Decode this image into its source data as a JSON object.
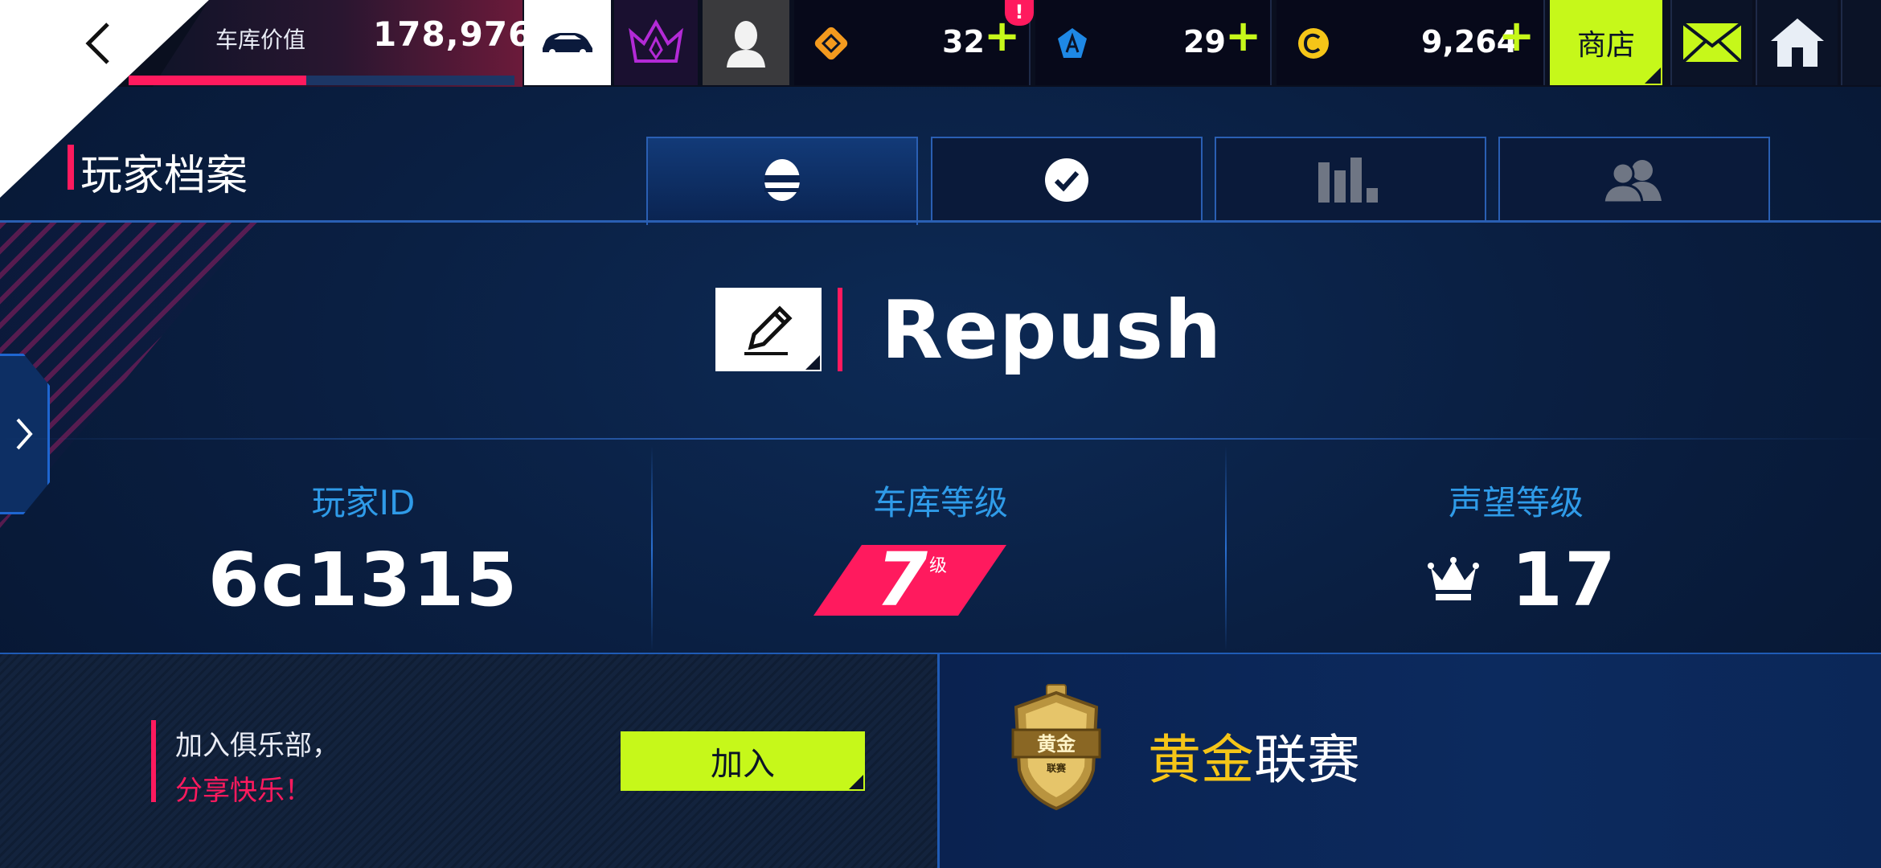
{
  "topbar": {
    "garage_value_label": "车库价值",
    "garage_value": "178,976",
    "garage_value_progress": 0.46,
    "tokens": "32",
    "blueprints": "29",
    "credits": "9,264",
    "plus": "+",
    "alert": "!",
    "shop_label": "商店",
    "icons": [
      "back-icon",
      "car-icon",
      "crown-icon",
      "avatar-icon",
      "token-icon",
      "blueprint-icon",
      "credit-icon",
      "mail-icon",
      "home-icon"
    ],
    "colors": {
      "accent_green": "#c6f81a",
      "accent_pink": "#ff1a5e",
      "tab_blue": "#2a5fb3"
    }
  },
  "header": {
    "title": "玩家档案",
    "tabs": [
      {
        "id": "profile",
        "icon": "helmet-icon",
        "active": true
      },
      {
        "id": "achievements",
        "icon": "check-icon",
        "active": false
      },
      {
        "id": "stats",
        "icon": "bar-chart-icon",
        "active": false
      },
      {
        "id": "friends",
        "icon": "friends-icon",
        "active": false
      }
    ]
  },
  "player": {
    "name": "Repush",
    "id_label": "玩家ID",
    "id": "6c1315",
    "garage_level_label": "车库等级",
    "garage_level": "7",
    "garage_level_unit": "级",
    "prestige_label": "声望等级",
    "prestige_level": "17"
  },
  "club": {
    "line1": "加入俱乐部，",
    "line2": "分享快乐！",
    "join_label": "加入"
  },
  "league": {
    "badge_text": "黄金",
    "badge_subtext": "联赛",
    "name_highlight": "黄金",
    "name_rest": "联赛"
  }
}
